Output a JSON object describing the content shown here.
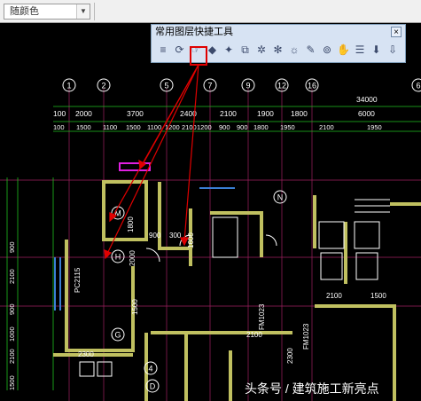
{
  "top_toolbar": {
    "color_select_value": "随颜色",
    "dropdown_glyph": "▼"
  },
  "layer_toolbar": {
    "title": "常用图层快捷工具",
    "close_glyph": "×",
    "icons": [
      {
        "name": "layer-stack-icon",
        "glyph": "≡"
      },
      {
        "name": "layer-refresh-icon",
        "glyph": "⟳"
      },
      {
        "name": "layer-hand-icon",
        "glyph": "☞"
      },
      {
        "name": "layer-shape-icon",
        "glyph": "◆"
      },
      {
        "name": "bulb-on-icon",
        "glyph": "✦"
      },
      {
        "name": "layer-copy-icon",
        "glyph": "⧉"
      },
      {
        "name": "layer-gear-icon",
        "glyph": "✲"
      },
      {
        "name": "layer-gear-alt-icon",
        "glyph": "✻"
      },
      {
        "name": "sun-icon",
        "glyph": "☼"
      },
      {
        "name": "layer-brush-icon",
        "glyph": "✎"
      },
      {
        "name": "layer-lock-icon",
        "glyph": "⊚"
      },
      {
        "name": "layer-hand2-icon",
        "glyph": "✋"
      },
      {
        "name": "layer-list-icon",
        "glyph": "☰"
      },
      {
        "name": "layer-merge-icon",
        "glyph": "⬇"
      },
      {
        "name": "layer-export-icon",
        "glyph": "⇩"
      }
    ]
  },
  "drawing": {
    "axis_labels": [
      "1",
      "2",
      "5",
      "7",
      "9",
      "12",
      "16"
    ],
    "right_axis_label": "6",
    "lower_axis_label": "4",
    "overall_dim": "34000",
    "dims_row1": [
      "100",
      "2000",
      "3700",
      "2400",
      "2100",
      "1900",
      "1800",
      "6000"
    ],
    "dims_row2": [
      "100",
      "1500",
      "1100",
      "1500",
      "1100",
      "1200",
      "2100",
      "1200",
      "900",
      "900",
      "1800",
      "1950",
      "2100",
      "1950"
    ],
    "left_dims": [
      "900",
      "2100",
      "900",
      "1000",
      "2100",
      "1500"
    ],
    "room_labels": [
      "M",
      "N",
      "H",
      "G",
      "D"
    ],
    "misc_text": [
      {
        "t": "1800"
      },
      {
        "t": "2000"
      },
      {
        "t": "900"
      },
      {
        "t": "300"
      },
      {
        "t": "1500"
      },
      {
        "t": "1600"
      },
      {
        "t": "PC2115"
      },
      {
        "t": "2100"
      },
      {
        "t": "1500"
      },
      {
        "t": "2300"
      },
      {
        "t": "2100"
      },
      {
        "t": "FM1023"
      },
      {
        "t": "FM1023"
      },
      {
        "t": "2300"
      }
    ]
  },
  "watermark": "头条号 / 建筑施工新亮点"
}
